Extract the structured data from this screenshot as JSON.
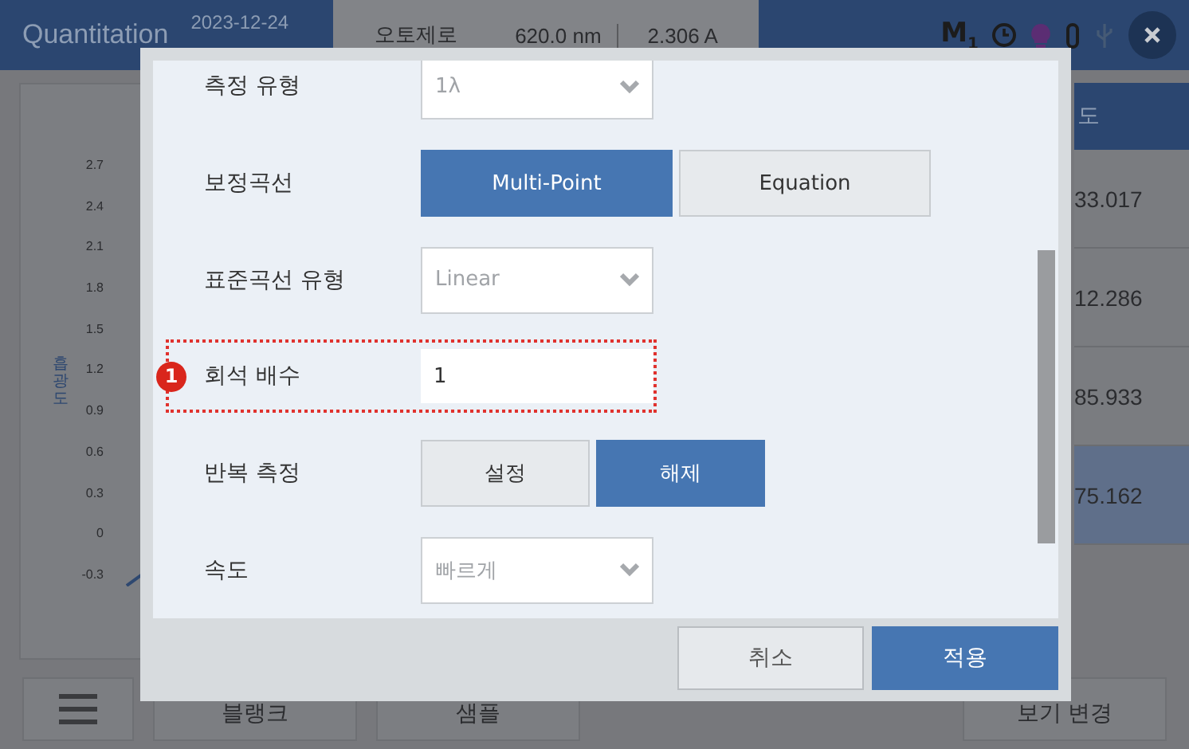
{
  "header": {
    "title": "Quantitation",
    "date": "2023-12-24",
    "segments": [
      "오토제로",
      "620.0 nm",
      "2.306 A"
    ],
    "mode_badge": "M",
    "mode_number": "1"
  },
  "chart": {
    "y_axis_label": "흡광도",
    "y_ticks": [
      "2.7",
      "2.4",
      "2.1",
      "1.8",
      "1.5",
      "1.2",
      "0.9",
      "0.6",
      "0.3",
      "0",
      "-0.3"
    ]
  },
  "table": {
    "column": "도",
    "rows": [
      {
        "value": "33.017",
        "selected": false
      },
      {
        "value": "12.286",
        "selected": false
      },
      {
        "value": "85.933",
        "selected": false
      },
      {
        "value": "75.162",
        "selected": true
      }
    ]
  },
  "bottom_bar": {
    "buttons": [
      "블랭크",
      "샘플",
      "보기 변경"
    ]
  },
  "dialog": {
    "rows": [
      {
        "kind": "dropdown",
        "label": "측정 유형",
        "value": "1λ",
        "highlighted": false
      },
      {
        "kind": "toggle",
        "label": "보정곡선",
        "options": [
          {
            "label": "Multi-Point",
            "selected": true
          },
          {
            "label": "Equation",
            "selected": false
          }
        ],
        "highlighted": false
      },
      {
        "kind": "dropdown",
        "label": "표준곡선 유형",
        "value": "Linear",
        "highlighted": false
      },
      {
        "kind": "input",
        "label": "회석 배수",
        "value": "1",
        "highlighted": true,
        "marker": "1"
      },
      {
        "kind": "toggle",
        "label": "반복 측정",
        "options": [
          {
            "label": "설정",
            "selected": false
          },
          {
            "label": "해제",
            "selected": true
          }
        ],
        "highlighted": false
      },
      {
        "kind": "dropdown",
        "label": "속도",
        "value": "빠르게",
        "highlighted": false
      }
    ],
    "buttons": [
      {
        "label": "취소",
        "kind": "secondary"
      },
      {
        "label": "적용",
        "kind": "primary"
      }
    ]
  }
}
